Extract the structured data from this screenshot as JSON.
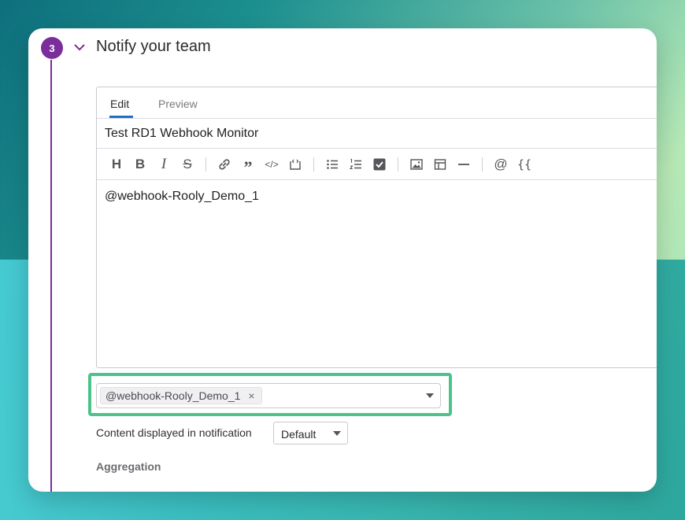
{
  "step": {
    "number": "3",
    "title": "Notify your team"
  },
  "editor": {
    "tabs": [
      {
        "label": "Edit",
        "active": true
      },
      {
        "label": "Preview",
        "active": false
      }
    ],
    "title_value": "Test RD1 Webhook Monitor",
    "toolbar": {
      "heading_glyph": "H",
      "bold_glyph": "B",
      "italic_glyph": "I",
      "strike_glyph": "S",
      "quote_glyph": "”",
      "code_glyph": "</>",
      "mention_glyph": "@",
      "variable_glyph": "{{"
    },
    "body_text": "@webhook-Rooly_Demo_1"
  },
  "recipients": {
    "chip_label": "@webhook-Rooly_Demo_1",
    "chip_remove": "×"
  },
  "content_displayed": {
    "label": "Content displayed in notification",
    "selected": "Default"
  },
  "aggregation": {
    "label": "Aggregation"
  },
  "colors": {
    "step_purple": "#7b2d9b",
    "tab_accent": "#1b72c9",
    "highlight_green": "#4cc38a"
  }
}
